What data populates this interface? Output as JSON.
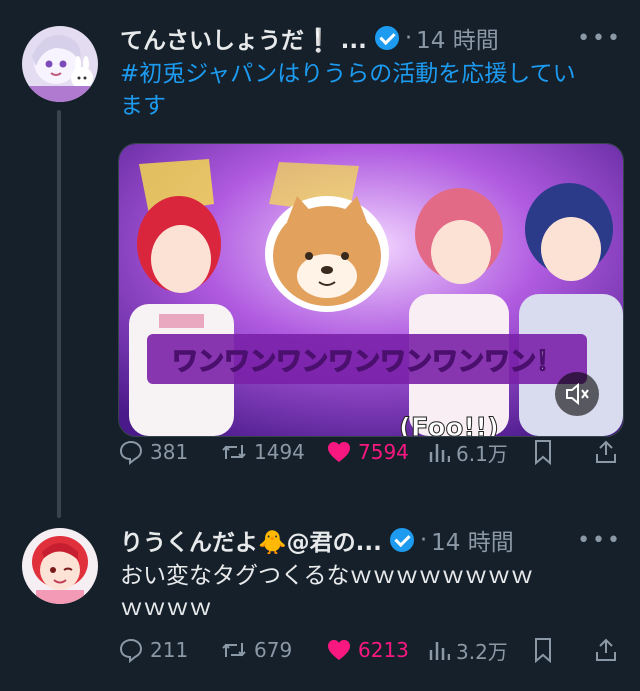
{
  "tweet1": {
    "display_name": "てんさいしょうだ❕ ...",
    "time": "14 時間",
    "more": "•••",
    "text_hashtag": "#初兎ジャパンはりうらの活動を応援し",
    "text_hashtag_cont": "てい",
    "text_plain": "ます",
    "media": {
      "banner_text": "ワンワンワンワンワンワンワン！",
      "caption": "(Foo!!)",
      "icon": "mute-icon"
    },
    "actions": {
      "replies": "381",
      "retweets": "1494",
      "likes": "7594",
      "views": "6.1万"
    }
  },
  "tweet2": {
    "display_name": "りうくんだよ🐥@君の...",
    "time": "14 時間",
    "more": "•••",
    "text_line1": "おい変なタグつくるなｗｗｗｗｗｗｗｗ",
    "text_line2": "ｗｗｗｗ",
    "actions": {
      "replies": "211",
      "retweets": "679",
      "likes": "6213",
      "views": "3.2万"
    }
  },
  "colors": {
    "background": "#15202b",
    "text": "#e7e9ea",
    "muted": "#8b98a5",
    "accent": "#1d9bf0",
    "like": "#f91880"
  }
}
